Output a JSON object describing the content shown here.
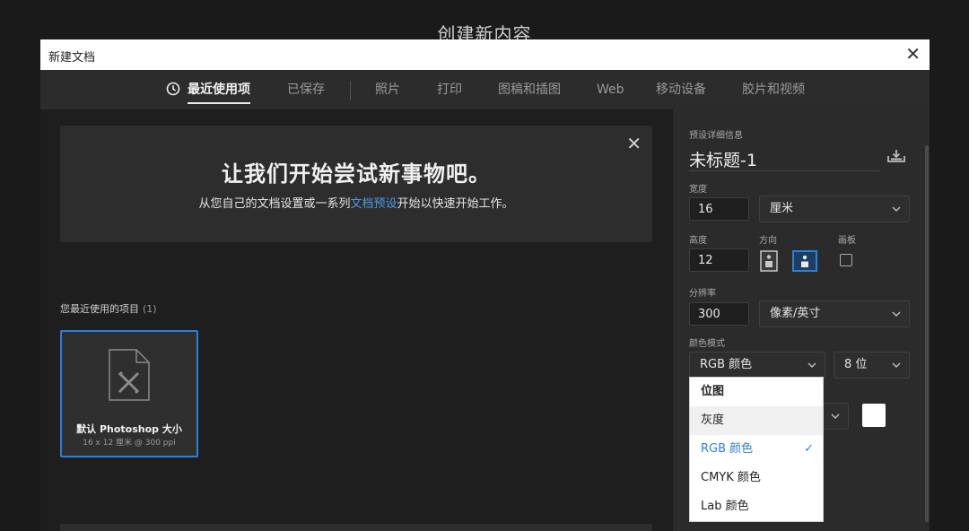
{
  "window": {
    "bg_title": "创建新内容",
    "title": "新建文档",
    "close_glyph": "✕"
  },
  "tabs": [
    {
      "label": "最近使用项",
      "active": true,
      "icon": "clock-icon"
    },
    {
      "label": "已保存"
    },
    {
      "label": "照片"
    },
    {
      "label": "打印"
    },
    {
      "label": "图稿和插图"
    },
    {
      "label": "Web"
    },
    {
      "label": "移动设备"
    },
    {
      "label": "胶片和视频"
    }
  ],
  "hero": {
    "title": "让我们开始尝试新事物吧。",
    "sub_before": "从您自己的文档设置或一系列",
    "sub_link": "文档预设",
    "sub_after": "开始以快速开始工作。",
    "close_glyph": "✕"
  },
  "recent": {
    "label": "您最近使用的项目",
    "count": "(1)",
    "items": [
      {
        "name": "默认 Photoshop 大小",
        "meta": "16 x 12 厘米 @ 300 ppi"
      }
    ]
  },
  "preset": {
    "section_label": "预设详细信息",
    "doc_name": "未标题-1",
    "width_label": "宽度",
    "width_value": "16",
    "width_unit": "厘米",
    "height_label": "高度",
    "height_value": "12",
    "orientation_label": "方向",
    "artboard_label": "画板",
    "resolution_label": "分辨率",
    "resolution_value": "300",
    "resolution_unit": "像素/英寸",
    "color_mode_label": "颜色模式",
    "color_mode_value": "RGB 颜色",
    "bit_depth": "8 位",
    "bg_color": "#ffffff"
  },
  "color_mode_dropdown": {
    "items": [
      {
        "label": "位图",
        "style": "header"
      },
      {
        "label": "灰度",
        "style": "hover"
      },
      {
        "label": "RGB 颜色",
        "style": "selected"
      },
      {
        "label": "CMYK 颜色"
      },
      {
        "label": "Lab 颜色"
      }
    ],
    "check_glyph": "✓"
  },
  "colors": {
    "accent": "#2d7fd9",
    "link": "#4d9ce8"
  }
}
